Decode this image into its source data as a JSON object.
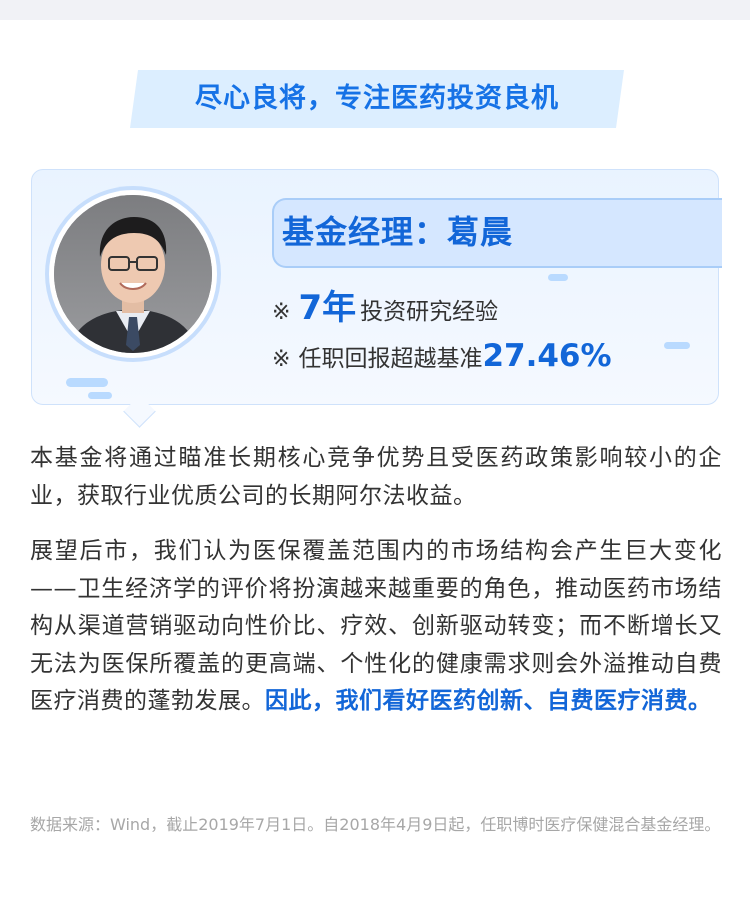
{
  "header": {
    "title": "尽心良将，专注医药投资良机"
  },
  "manager": {
    "name_label": "基金经理：葛晨",
    "facts": [
      {
        "mark": "※",
        "highlight": "7年",
        "text": "投资研究经验"
      },
      {
        "mark": "※",
        "text": "任职回报超越基准",
        "highlight": "27.46%"
      }
    ],
    "photo_icon": "manager-portrait"
  },
  "body": {
    "paragraph1": "本基金将通过瞄准长期核心竞争优势且受医药政策影响较小的企业，获取行业优质公司的长期阿尔法收益。",
    "paragraph2": "展望后市，我们认为医保覆盖范围内的市场结构会产生巨大变化——卫生经济学的评价将扮演越来越重要的角色，推动医药市场结构从渠道营销驱动向性价比、疗效、创新驱动转变；而不断增长又无法为医保所覆盖的更高端、个性化的健康需求则会外溢推动自费医疗消费的蓬勃发展。",
    "paragraph2_emphasis": "因此，我们看好医药创新、自费医疗消费。"
  },
  "footnote": "数据来源：Wind，截止2019年7月1日。自2018年4月9日起，任职博时医疗保健混合基金经理。",
  "colors": {
    "accent": "#1266d8",
    "banner_bg": "#dceeff",
    "card_bg": "#e9f3ff"
  }
}
